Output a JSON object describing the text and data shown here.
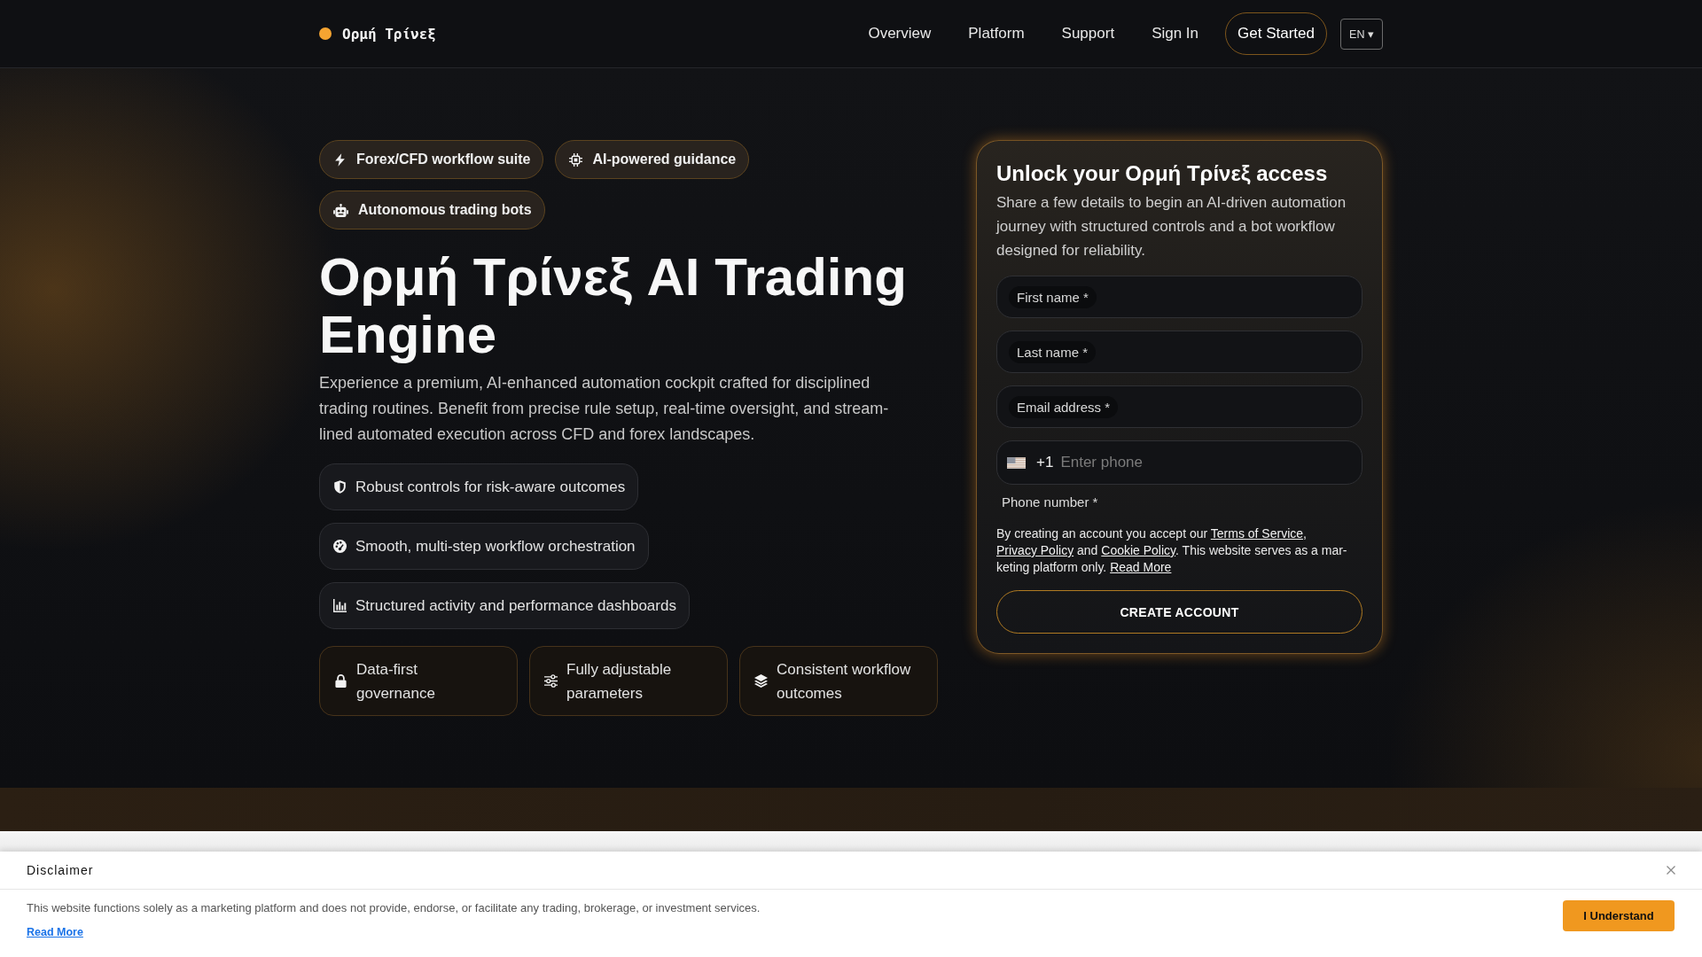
{
  "header": {
    "brand": "Ορμή Τρίνεξ",
    "nav": [
      "Overview",
      "Platform",
      "Support",
      "Sign In"
    ],
    "cta": "Get Started",
    "language": "EN ▾"
  },
  "hero": {
    "chips": [
      "Forex/CFD workflow suite",
      "AI-powered guidance",
      "Autonomous trading bots"
    ],
    "title": "Ορμή Τρίνεξ AI Trading Engine",
    "description": "Experience a premium, AI-enhanced automation cockpit crafted for disciplined trading routines. Benefit from precise rule setup, real-time oversight, and stream-lined automated execution across CFD and forex landscapes.",
    "features": [
      "Robust controls for risk-aware outcomes",
      "Smooth, multi-step workflow orchestration",
      "Structured activity and performance dashboards"
    ],
    "cards": [
      "Data-first governance",
      "Fully adjustable parameters",
      "Consistent workflow outcomes"
    ]
  },
  "signup": {
    "title": "Unlock your Ορμή Τρίνεξ access",
    "description": "Share a few details to begin an AI-driven automation journey with structured controls and a bot workflow designed for reliability.",
    "fields": [
      {
        "kind": "text",
        "label": "First name *"
      },
      {
        "kind": "text",
        "label": "Last name *"
      },
      {
        "kind": "text",
        "label": "Email address *"
      },
      {
        "kind": "phone",
        "dial_code": "+1",
        "placeholder": "Enter phone",
        "label": "Phone number *"
      }
    ],
    "consent": [
      {
        "kind": "text",
        "text": "By creating an account you accept our "
      },
      {
        "kind": "link",
        "text": "Terms of Service"
      },
      {
        "kind": "text",
        "text": ", "
      },
      {
        "kind": "link",
        "text": "Privacy Policy"
      },
      {
        "kind": "text",
        "text": " and "
      },
      {
        "kind": "link",
        "text": "Cookie Policy"
      },
      {
        "kind": "text",
        "text": ". This website serves as a mar-keting platform only. "
      },
      {
        "kind": "link",
        "text": "Read More"
      }
    ],
    "submit": "CREATE ACCOUNT"
  },
  "disclaimer": {
    "title": "Disclaimer",
    "text": "This website functions solely as a marketing platform and does not provide, endorse, or facilitate any trading, brokerage, or investment services.",
    "link": "Read More",
    "button": "I Understand"
  }
}
